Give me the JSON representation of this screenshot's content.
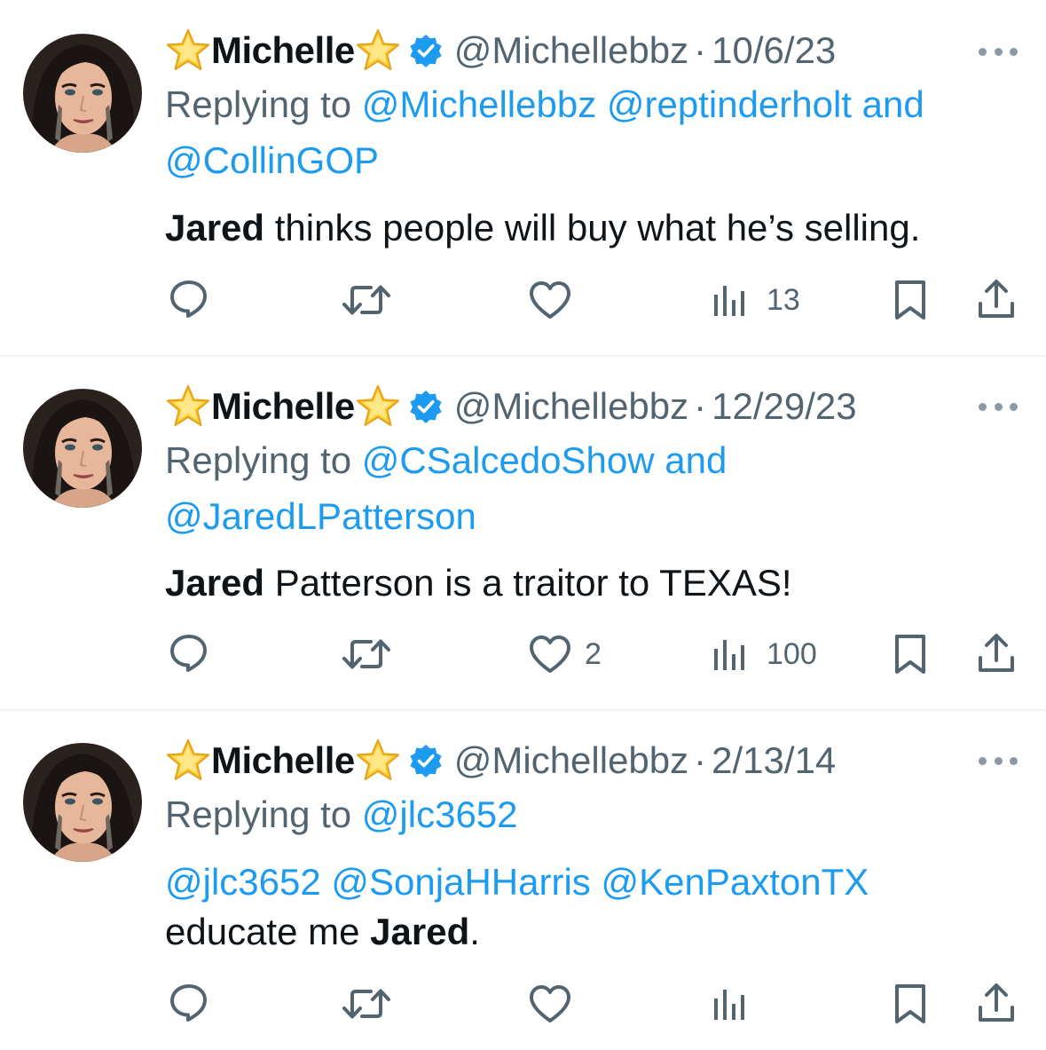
{
  "colors": {
    "link": "#1d9bf0",
    "muted": "#536471",
    "text": "#0f1419",
    "verified": "#1d9bf0",
    "divider": "#eff3f4"
  },
  "icons": {
    "name_prefix": "star-emoji",
    "name_suffix": "star-emoji",
    "verified": "verified-badge",
    "more": "more-dots",
    "reply": "reply-bubble",
    "repost": "repost-arrows",
    "like": "heart",
    "views": "bar-chart",
    "bookmark": "bookmark",
    "share": "share-upload"
  },
  "tweets": [
    {
      "name": "Michelle",
      "handle": "@Michellebbz",
      "separator": "·",
      "date": "10/6/23",
      "replying_prefix": "Replying to",
      "replying_line1": "@Michellebbz @reptinderholt and",
      "replying_line2": "@CollinGOP",
      "body_bold": "Jared",
      "body_rest": " thinks people will buy what he’s selling.",
      "likes": "",
      "views": "13"
    },
    {
      "name": "Michelle",
      "handle": "@Michellebbz",
      "separator": "·",
      "date": "12/29/23",
      "replying_prefix": "Replying to",
      "replying_line1": "@CSalcedoShow and",
      "replying_line2": "@JaredLPatterson",
      "body_bold": "Jared",
      "body_rest": " Patterson is a traitor to TEXAS!",
      "likes": "2",
      "views": "100"
    },
    {
      "name": "Michelle",
      "handle": "@Michellebbz",
      "separator": "·",
      "date": "2/13/14",
      "replying_prefix": "Replying to",
      "replying_line1": "@jlc3652",
      "body_mentions": "@jlc3652 @SonjaHHarris @KenPaxtonTX",
      "body_line2_prefix": "educate me ",
      "body_line2_bold": "Jared",
      "body_line2_suffix": ".",
      "likes": "",
      "views": ""
    }
  ]
}
